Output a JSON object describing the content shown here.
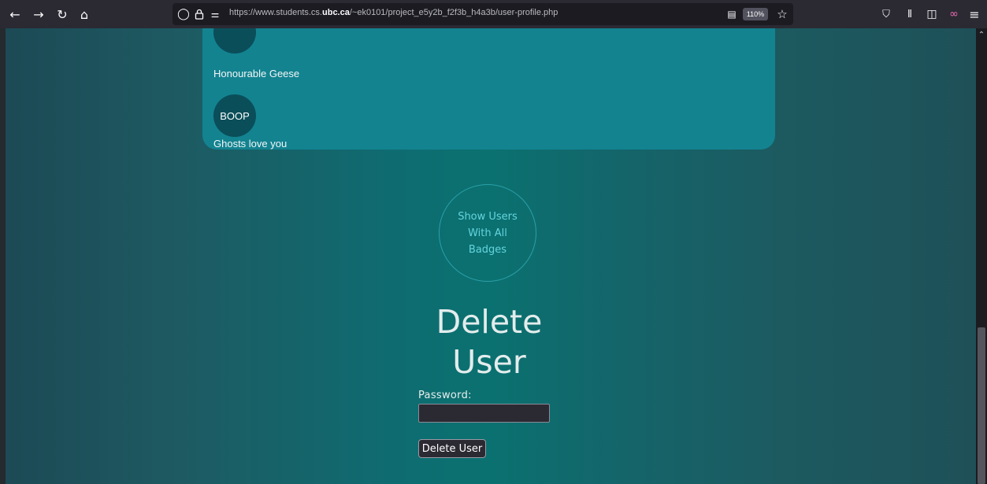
{
  "browser": {
    "url_prefix": "https://www.students.cs.",
    "url_domain": "ubc.ca",
    "url_suffix": "/~ek0101/project_e5y2b_f2f3b_h4a3b/user-profile.php",
    "zoom": "110%",
    "icons": {
      "back": "←",
      "forward": "→",
      "reload": "↻",
      "home": "⌂",
      "shield": "◯",
      "lock": "🔒",
      "permissions": "⚌",
      "reader": "▤",
      "bookmark": "☆",
      "pocket": "⛉",
      "library": "⫴",
      "sidebar": "◫",
      "extension": "∞",
      "menu": "≡"
    }
  },
  "badges": {
    "items": [
      {
        "icon_text": "",
        "label": "Honourable Geese"
      },
      {
        "icon_text": "BOOP",
        "label": "Ghosts love you"
      }
    ]
  },
  "show_users_button": {
    "label": "Show Users With All Badges"
  },
  "delete_user": {
    "title": "Delete User",
    "password_label": "Password:",
    "password_value": "",
    "submit_label": "Delete User"
  },
  "scrollbar": {
    "up_arrow": "⌃"
  },
  "colors": {
    "card": "#138390",
    "badge_circle": "#0a4e59",
    "accent_text": "#63d4de",
    "toolbar": "#2b2a33"
  }
}
